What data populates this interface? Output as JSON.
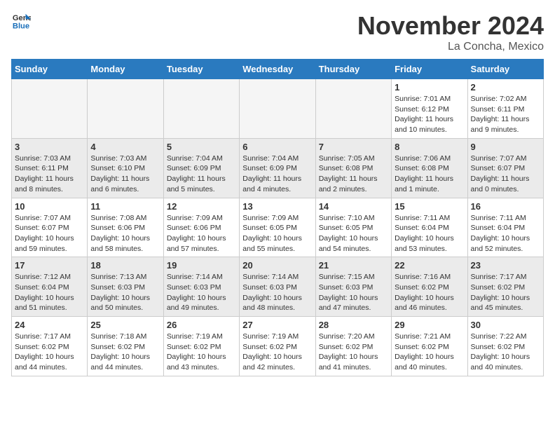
{
  "header": {
    "logo_general": "General",
    "logo_blue": "Blue",
    "month_title": "November 2024",
    "location": "La Concha, Mexico"
  },
  "weekdays": [
    "Sunday",
    "Monday",
    "Tuesday",
    "Wednesday",
    "Thursday",
    "Friday",
    "Saturday"
  ],
  "weeks": [
    {
      "alt": false,
      "days": [
        {
          "num": "",
          "info": "",
          "empty": true
        },
        {
          "num": "",
          "info": "",
          "empty": true
        },
        {
          "num": "",
          "info": "",
          "empty": true
        },
        {
          "num": "",
          "info": "",
          "empty": true
        },
        {
          "num": "",
          "info": "",
          "empty": true
        },
        {
          "num": "1",
          "info": "Sunrise: 7:01 AM\nSunset: 6:12 PM\nDaylight: 11 hours\nand 10 minutes.",
          "empty": false
        },
        {
          "num": "2",
          "info": "Sunrise: 7:02 AM\nSunset: 6:11 PM\nDaylight: 11 hours\nand 9 minutes.",
          "empty": false
        }
      ]
    },
    {
      "alt": true,
      "days": [
        {
          "num": "3",
          "info": "Sunrise: 7:03 AM\nSunset: 6:11 PM\nDaylight: 11 hours\nand 8 minutes.",
          "empty": false
        },
        {
          "num": "4",
          "info": "Sunrise: 7:03 AM\nSunset: 6:10 PM\nDaylight: 11 hours\nand 6 minutes.",
          "empty": false
        },
        {
          "num": "5",
          "info": "Sunrise: 7:04 AM\nSunset: 6:09 PM\nDaylight: 11 hours\nand 5 minutes.",
          "empty": false
        },
        {
          "num": "6",
          "info": "Sunrise: 7:04 AM\nSunset: 6:09 PM\nDaylight: 11 hours\nand 4 minutes.",
          "empty": false
        },
        {
          "num": "7",
          "info": "Sunrise: 7:05 AM\nSunset: 6:08 PM\nDaylight: 11 hours\nand 2 minutes.",
          "empty": false
        },
        {
          "num": "8",
          "info": "Sunrise: 7:06 AM\nSunset: 6:08 PM\nDaylight: 11 hours\nand 1 minute.",
          "empty": false
        },
        {
          "num": "9",
          "info": "Sunrise: 7:07 AM\nSunset: 6:07 PM\nDaylight: 11 hours\nand 0 minutes.",
          "empty": false
        }
      ]
    },
    {
      "alt": false,
      "days": [
        {
          "num": "10",
          "info": "Sunrise: 7:07 AM\nSunset: 6:07 PM\nDaylight: 10 hours\nand 59 minutes.",
          "empty": false
        },
        {
          "num": "11",
          "info": "Sunrise: 7:08 AM\nSunset: 6:06 PM\nDaylight: 10 hours\nand 58 minutes.",
          "empty": false
        },
        {
          "num": "12",
          "info": "Sunrise: 7:09 AM\nSunset: 6:06 PM\nDaylight: 10 hours\nand 57 minutes.",
          "empty": false
        },
        {
          "num": "13",
          "info": "Sunrise: 7:09 AM\nSunset: 6:05 PM\nDaylight: 10 hours\nand 55 minutes.",
          "empty": false
        },
        {
          "num": "14",
          "info": "Sunrise: 7:10 AM\nSunset: 6:05 PM\nDaylight: 10 hours\nand 54 minutes.",
          "empty": false
        },
        {
          "num": "15",
          "info": "Sunrise: 7:11 AM\nSunset: 6:04 PM\nDaylight: 10 hours\nand 53 minutes.",
          "empty": false
        },
        {
          "num": "16",
          "info": "Sunrise: 7:11 AM\nSunset: 6:04 PM\nDaylight: 10 hours\nand 52 minutes.",
          "empty": false
        }
      ]
    },
    {
      "alt": true,
      "days": [
        {
          "num": "17",
          "info": "Sunrise: 7:12 AM\nSunset: 6:04 PM\nDaylight: 10 hours\nand 51 minutes.",
          "empty": false
        },
        {
          "num": "18",
          "info": "Sunrise: 7:13 AM\nSunset: 6:03 PM\nDaylight: 10 hours\nand 50 minutes.",
          "empty": false
        },
        {
          "num": "19",
          "info": "Sunrise: 7:14 AM\nSunset: 6:03 PM\nDaylight: 10 hours\nand 49 minutes.",
          "empty": false
        },
        {
          "num": "20",
          "info": "Sunrise: 7:14 AM\nSunset: 6:03 PM\nDaylight: 10 hours\nand 48 minutes.",
          "empty": false
        },
        {
          "num": "21",
          "info": "Sunrise: 7:15 AM\nSunset: 6:03 PM\nDaylight: 10 hours\nand 47 minutes.",
          "empty": false
        },
        {
          "num": "22",
          "info": "Sunrise: 7:16 AM\nSunset: 6:02 PM\nDaylight: 10 hours\nand 46 minutes.",
          "empty": false
        },
        {
          "num": "23",
          "info": "Sunrise: 7:17 AM\nSunset: 6:02 PM\nDaylight: 10 hours\nand 45 minutes.",
          "empty": false
        }
      ]
    },
    {
      "alt": false,
      "days": [
        {
          "num": "24",
          "info": "Sunrise: 7:17 AM\nSunset: 6:02 PM\nDaylight: 10 hours\nand 44 minutes.",
          "empty": false
        },
        {
          "num": "25",
          "info": "Sunrise: 7:18 AM\nSunset: 6:02 PM\nDaylight: 10 hours\nand 44 minutes.",
          "empty": false
        },
        {
          "num": "26",
          "info": "Sunrise: 7:19 AM\nSunset: 6:02 PM\nDaylight: 10 hours\nand 43 minutes.",
          "empty": false
        },
        {
          "num": "27",
          "info": "Sunrise: 7:19 AM\nSunset: 6:02 PM\nDaylight: 10 hours\nand 42 minutes.",
          "empty": false
        },
        {
          "num": "28",
          "info": "Sunrise: 7:20 AM\nSunset: 6:02 PM\nDaylight: 10 hours\nand 41 minutes.",
          "empty": false
        },
        {
          "num": "29",
          "info": "Sunrise: 7:21 AM\nSunset: 6:02 PM\nDaylight: 10 hours\nand 40 minutes.",
          "empty": false
        },
        {
          "num": "30",
          "info": "Sunrise: 7:22 AM\nSunset: 6:02 PM\nDaylight: 10 hours\nand 40 minutes.",
          "empty": false
        }
      ]
    }
  ]
}
